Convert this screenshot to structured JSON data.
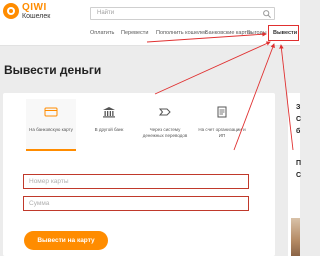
{
  "header": {
    "logo_name": "QIWI",
    "logo_sub": "Кошелек",
    "search_placeholder": "Найти",
    "nav": [
      {
        "label": "Оплатить"
      },
      {
        "label": "Перевести"
      },
      {
        "label": "Пополнить кошелек"
      },
      {
        "label": "Банковские карты"
      },
      {
        "label": "Выгоды"
      },
      {
        "label": "Вывести"
      }
    ]
  },
  "page": {
    "title": "Вывести деньги"
  },
  "methods": [
    {
      "label": "На банковскую карту",
      "icon": "card-icon",
      "active": true
    },
    {
      "label": "В другой банк",
      "icon": "bank-icon",
      "active": false
    },
    {
      "label": "Через систему денежных переводов",
      "icon": "transfer-icon",
      "active": false
    },
    {
      "label": "На счет организации и ИП",
      "icon": "document-icon",
      "active": false
    }
  ],
  "form": {
    "card_number_placeholder": "Номер карты",
    "amount_placeholder": "Сумма",
    "submit_label": "Вывести на карту"
  },
  "side_ad": {
    "letters": [
      "З",
      "С",
      "б",
      "П",
      "С"
    ]
  },
  "colors": {
    "brand": "#ff8c00",
    "annotation": "#e03030"
  }
}
